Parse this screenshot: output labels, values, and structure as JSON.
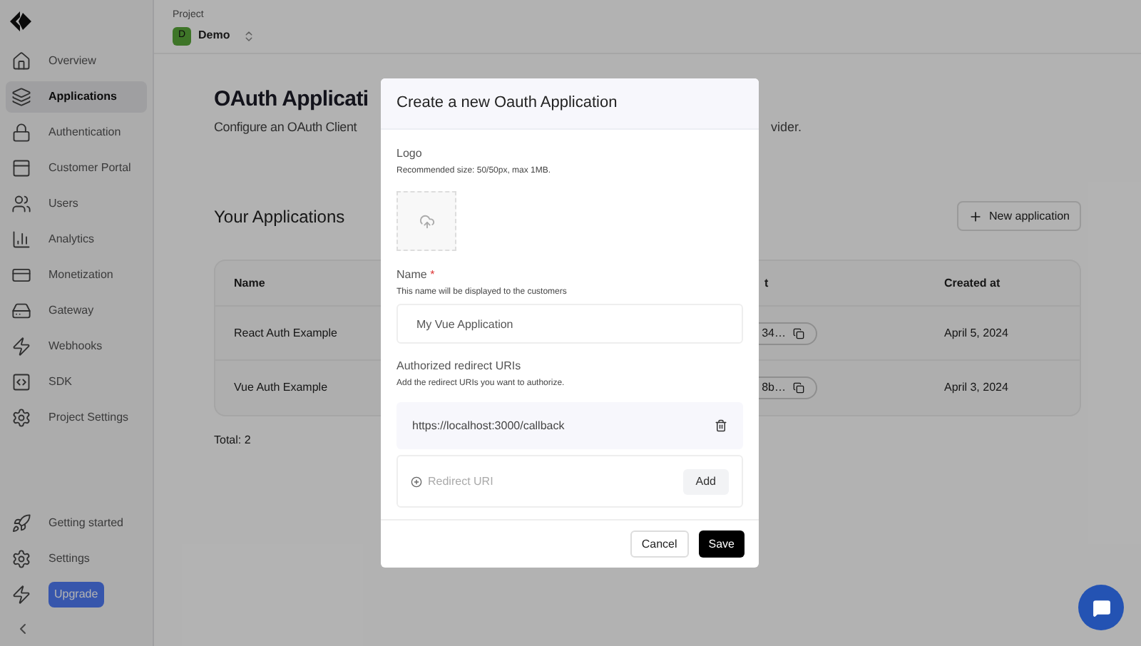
{
  "sidebar": {
    "items": [
      {
        "label": "Overview",
        "selected": false
      },
      {
        "label": "Applications",
        "selected": true
      },
      {
        "label": "Authentication",
        "selected": false
      },
      {
        "label": "Customer Portal",
        "selected": false
      },
      {
        "label": "Users",
        "selected": false
      },
      {
        "label": "Analytics",
        "selected": false
      },
      {
        "label": "Monetization",
        "selected": false
      },
      {
        "label": "Gateway",
        "selected": false
      },
      {
        "label": "Webhooks",
        "selected": false
      },
      {
        "label": "SDK",
        "selected": false
      },
      {
        "label": "Project Settings",
        "selected": false
      }
    ],
    "footer_items": [
      {
        "kind": "link",
        "label": "Getting started"
      },
      {
        "kind": "link",
        "label": "Settings"
      },
      {
        "kind": "badge",
        "label": "Upgrade"
      }
    ]
  },
  "project": {
    "label": "Project",
    "avatar": "D",
    "name": "Demo"
  },
  "page": {
    "title": "OAuth Applicati",
    "subtitle_start": "Configure an OAuth Client",
    "subtitle_end": "vider.",
    "section_title": "Your Applications",
    "new_button": "New application",
    "table": {
      "columns": [
        "Name",
        "t",
        "Created at"
      ],
      "rows": [
        {
          "name": "React Auth Example",
          "column_2": "34…",
          "created": "April 5, 2024"
        },
        {
          "name": "Vue Auth Example",
          "column_2": "8b…",
          "created": "April 3, 2024"
        }
      ]
    },
    "total": "Total: 2"
  },
  "modal": {
    "title": "Create a new Oauth Application",
    "logo_label": "Logo",
    "logo_hint": "Recommended size: 50/50px, max 1MB.",
    "name_label": "Name",
    "required_mark": "*",
    "name_hint": "This name will be displayed to the customers",
    "name_value": "My Vue Application",
    "uris_label": "Authorized redirect URIs",
    "uris_hint": "Add the redirect URIs you want to authorize.",
    "uris": [
      {
        "url": "https://localhost:3000/callback"
      }
    ],
    "new_uri_placeholder": "Redirect URI",
    "add_button": "Add",
    "cancel_button": "Cancel",
    "save_button": "Save"
  }
}
